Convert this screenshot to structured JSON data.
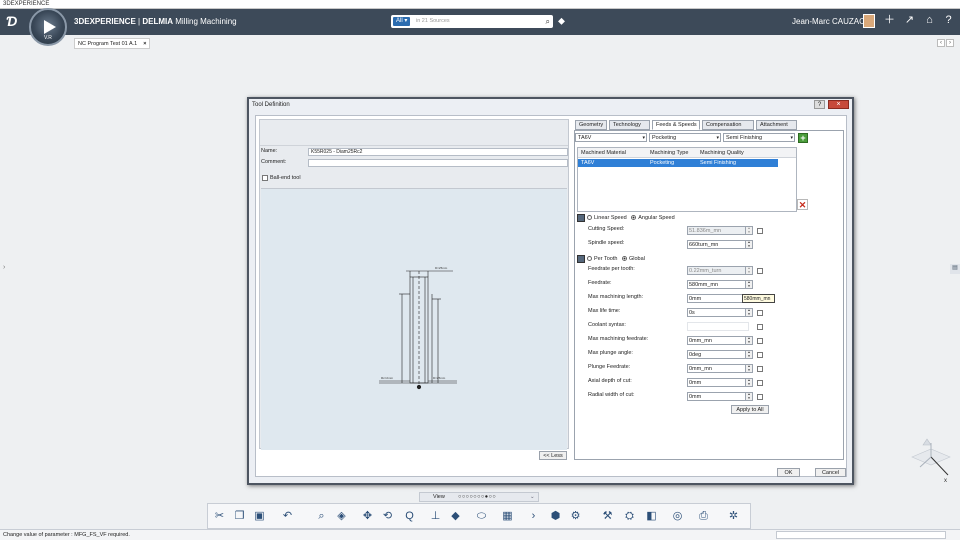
{
  "window_title": "3DEXPERIENCE",
  "app": {
    "brand": "3DEXPERIENCE",
    "separator": " | ",
    "product": "DELMIA",
    "app_name": "Milling Machining",
    "compass_version": "V.R"
  },
  "search": {
    "scope": "All",
    "placeholder": "in 21 Sources"
  },
  "user": {
    "name": "Jean-Marc CAUZAC"
  },
  "tab": {
    "label": "NC Program Test 01 A.1",
    "close": "×"
  },
  "dialog": {
    "title": "Tool Definition",
    "help": "?",
    "close": "×",
    "name_label": "Name:",
    "name_value": "K55R025 - Diam25Rc2",
    "comment_label": "Comment:",
    "comment_value": "",
    "ball_end_label": "Ball-end tool",
    "less_button": "<< Less",
    "ok_button": "OK",
    "cancel_button": "Cancel",
    "tabs": [
      "Geometry",
      "Technology",
      "Feeds & Speeds",
      "Compensation",
      "Attachment"
    ],
    "active_tab": "Feeds & Speeds",
    "material_combo": "TA6V",
    "machining_type_combo": "Pocketing",
    "quality_combo": "Semi Finishing",
    "table": {
      "columns": [
        "Machined Material",
        "Machining Type",
        "Machining Quality"
      ],
      "rows": [
        [
          "TA6V",
          "Pocketing",
          "Semi Finishing"
        ]
      ]
    },
    "speed_mode": {
      "linear": "Linear Speed",
      "angular": "Angular Speed",
      "selected": "Angular Speed"
    },
    "cutting_speed": {
      "label": "Cutting Speed:",
      "value": "51.836m_mn"
    },
    "spindle_speed": {
      "label": "Spindle speed:",
      "value": "660turn_mn"
    },
    "feed_mode": {
      "per_tooth": "Per Tooth",
      "global": "Global",
      "selected": "Global"
    },
    "feed_per_tooth": {
      "label": "Feedrate per tooth:",
      "value": "0.22mm_turn"
    },
    "feedrate": {
      "label": "Feedrate:",
      "value": "580mm_mn"
    },
    "max_machining_length": {
      "label": "Max machining length:",
      "value": "0mm"
    },
    "tooltip_value": "580mm_mn",
    "max_life_time": {
      "label": "Max life time:",
      "value": "0s"
    },
    "coolant_syntax": {
      "label": "Coolant syntax:",
      "value": ""
    },
    "max_machining_feedrate": {
      "label": "Max machining feedrate:",
      "value": "0mm_mn"
    },
    "max_plunge_angle": {
      "label": "Max plunge angle:",
      "value": "0deg"
    },
    "plunge_feedrate": {
      "label": "Plunge Feedrate:",
      "value": "0mm_mn"
    },
    "axial_depth": {
      "label": "Axial depth of cut:",
      "value": "0mm"
    },
    "radial_width": {
      "label": "Radial width of cut:",
      "value": "0mm"
    },
    "apply_to_all": "Apply to All"
  },
  "view_bar": {
    "label": "View",
    "dots": "○○○○○○○●○○"
  },
  "status": {
    "message": "Change value of parameter : MFG_FS_VF required."
  },
  "colors": {
    "topbar": "#3d4a59",
    "selection": "#2f7fd6",
    "close": "#c74a3b",
    "add": "#4a9c3a"
  },
  "icons": {
    "toolbar": [
      "cut-icon",
      "copy-icon",
      "paste-icon",
      "undo-icon",
      "zoom-icon",
      "cube-view-icon",
      "pan-icon",
      "rotate-icon",
      "axis-icon",
      "shading-icon",
      "cylinder-icon",
      "layout-icon",
      "next-icon",
      "part-icon",
      "settings-icon",
      "tool-icon",
      "machine-icon",
      "simulate-icon",
      "toolpath-icon",
      "output-icon",
      "sparkle-icon"
    ]
  }
}
